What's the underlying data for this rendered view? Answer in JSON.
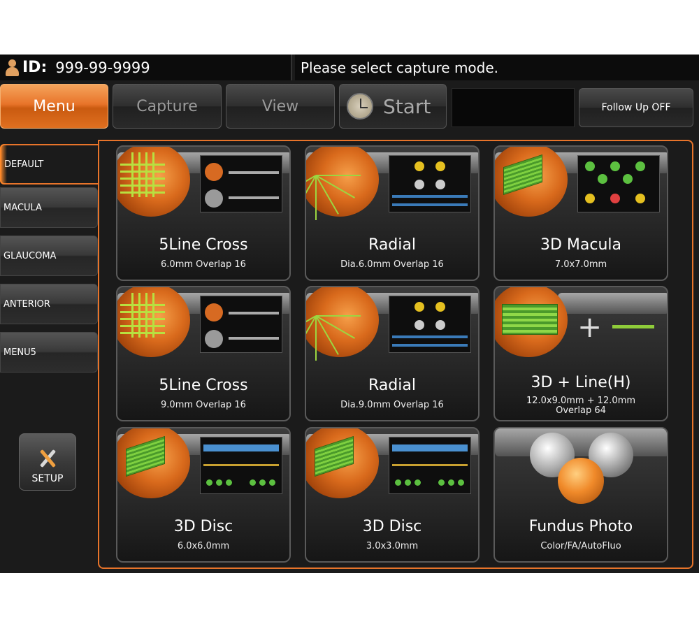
{
  "header": {
    "id_label": "ID:",
    "id_value": "999-99-9999",
    "message": "Please select capture mode."
  },
  "tabs": {
    "menu": "Menu",
    "capture": "Capture",
    "view": "View",
    "start": "Start",
    "follow_up": "Follow Up OFF"
  },
  "sidebar": {
    "items": [
      {
        "label": "DEFAULT"
      },
      {
        "label": "MACULA"
      },
      {
        "label": "GLAUCOMA"
      },
      {
        "label": "ANTERIOR"
      },
      {
        "label": "MENU5"
      }
    ],
    "setup_label": "SETUP"
  },
  "cards": [
    {
      "title": "5Line Cross",
      "subtitle": "6.0mm Overlap 16",
      "icon": "five-line-cross-scan-icon"
    },
    {
      "title": "Radial",
      "subtitle": "Dia.6.0mm Overlap 16",
      "icon": "radial-scan-icon"
    },
    {
      "title": "3D Macula",
      "subtitle": "7.0x7.0mm",
      "icon": "3d-macula-scan-icon"
    },
    {
      "title": "5Line Cross",
      "subtitle": "9.0mm Overlap 16",
      "icon": "five-line-cross-scan-icon"
    },
    {
      "title": "Radial",
      "subtitle": "Dia.9.0mm Overlap 16",
      "icon": "radial-scan-icon"
    },
    {
      "title": "3D + Line(H)",
      "subtitle": "12.0x9.0mm + 12.0mm",
      "subtitle2": "Overlap 64",
      "icon": "3d-plus-line-scan-icon"
    },
    {
      "title": "3D Disc",
      "subtitle": "6.0x6.0mm",
      "icon": "3d-disc-scan-icon"
    },
    {
      "title": "3D Disc",
      "subtitle": "3.0x3.0mm",
      "icon": "3d-disc-scan-icon"
    },
    {
      "title": "Fundus Photo",
      "subtitle": "Color/FA/AutoFluo",
      "icon": "fundus-photo-icon"
    }
  ],
  "colors": {
    "accent": "#e8742a",
    "background": "#1b1b1b",
    "scan_green": "#8fcc3a"
  }
}
